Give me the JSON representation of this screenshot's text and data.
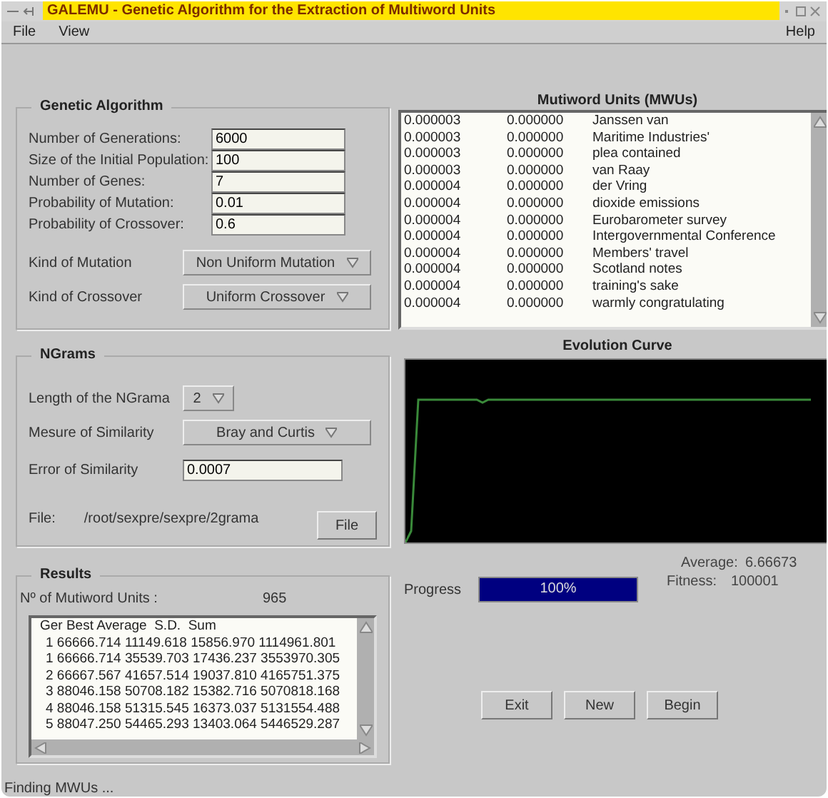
{
  "window": {
    "title": "GALEMU - Genetic Algorithm for the Extraction of Multiword Units"
  },
  "menu": [
    {
      "label": "File"
    },
    {
      "label": "View"
    },
    {
      "label": "Help"
    }
  ],
  "genetic_algorithm": {
    "title": "Genetic Algorithm",
    "fields": [
      {
        "label": "Number of Generations:",
        "value": "6000"
      },
      {
        "label": "Size of the Initial Population:",
        "value": "100"
      },
      {
        "label": "Number of Genes:",
        "value": "7"
      },
      {
        "label": "Probability of Mutation:",
        "value": "0.01"
      },
      {
        "label": "Probability of Crossover:",
        "value": "0.6"
      }
    ],
    "dropdowns": [
      {
        "label": "Kind of Mutation",
        "value": "Non Uniform Mutation"
      },
      {
        "label": "Kind of Crossover",
        "value": "Uniform Crossover"
      }
    ]
  },
  "ngrams": {
    "title": "NGrams",
    "length_label": "Length of the NGrama",
    "length_value": "2",
    "similarity_label": "Mesure of Similarity",
    "similarity_value": "Bray and Curtis",
    "error_label": "Error of Similarity",
    "error_value": "0.0007",
    "file_label": "File:",
    "file_path": "/root/sexpre/sexpre/2grama",
    "file_button": "File"
  },
  "results": {
    "title": "Results",
    "count_label": "Nº of Mutiword Units :",
    "count_value": "965",
    "header": "Ger Best Average  S.D.  Sum",
    "rows": [
      "1 66666.714 11149.618 15856.970 1114961.801",
      "1 66666.714 35539.703 17436.237 3553970.305",
      "2 66667.567 41657.514 19037.810 4165751.375",
      "3 88046.158 50708.182 15382.716 5070818.168",
      "4 88046.158 51315.545 16373.037 5131554.488",
      "5 88047.250 54465.293 13403.064 5446529.287"
    ]
  },
  "mwu": {
    "title": "Mutiword Units (MWUs)",
    "rows": [
      [
        "0.000003",
        "0.000000",
        "Janssen van"
      ],
      [
        "0.000003",
        "0.000000",
        "Maritime Industries'"
      ],
      [
        "0.000003",
        "0.000000",
        "plea contained"
      ],
      [
        "0.000003",
        "0.000000",
        "van Raay"
      ],
      [
        "0.000004",
        "0.000000",
        "der Vring"
      ],
      [
        "0.000004",
        "0.000000",
        "dioxide emissions"
      ],
      [
        "0.000004",
        "0.000000",
        "Eurobarometer survey"
      ],
      [
        "0.000004",
        "0.000000",
        "Intergovernmental Conference"
      ],
      [
        "0.000004",
        "0.000000",
        "Members' travel"
      ],
      [
        "0.000004",
        "0.000000",
        "Scotland notes"
      ],
      [
        "0.000004",
        "0.000000",
        "training's sake"
      ],
      [
        "0.000004",
        "0.000000",
        "warmly congratulating"
      ]
    ]
  },
  "evolution": {
    "title": "Evolution Curve",
    "average_label": "Average:",
    "average_value": "6.66673",
    "fitness_label": "Fitness:",
    "fitness_value": "100001"
  },
  "progress": {
    "label": "Progress",
    "level": 1,
    "text": "100%"
  },
  "buttons": [
    "Exit",
    "New",
    "Begin"
  ],
  "status_bar": "Finding MWUs ..."
}
